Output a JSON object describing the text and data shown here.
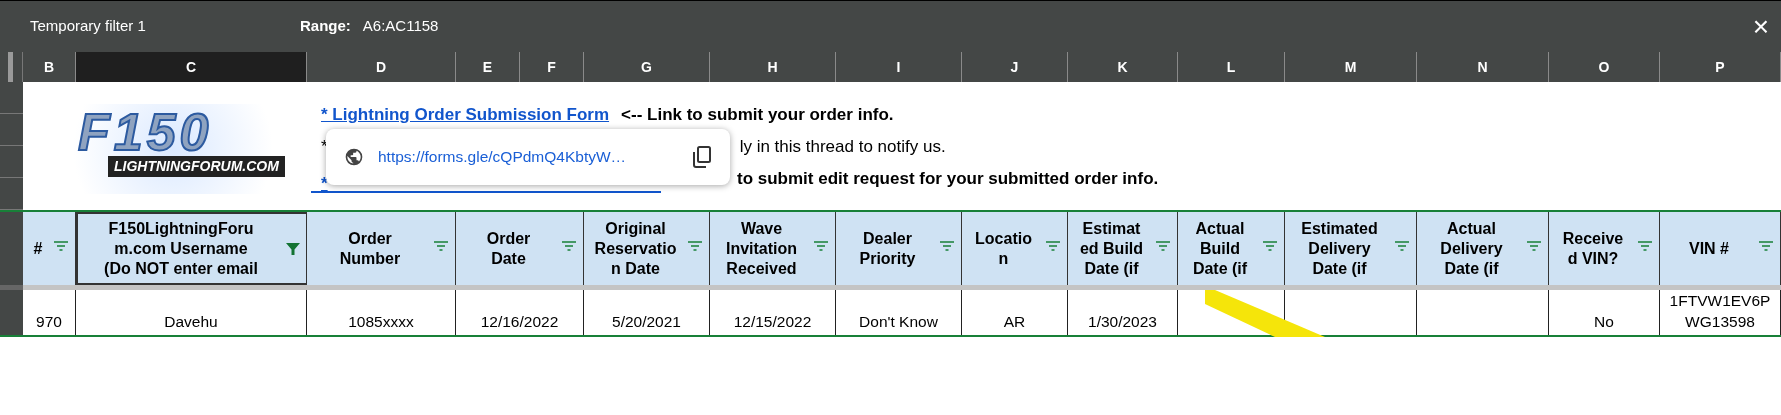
{
  "filter_bar": {
    "title": "Temporary filter 1",
    "range_label": "Range:",
    "range_value": "A6:AC1158",
    "close": "×"
  },
  "column_letters": [
    {
      "label": "B",
      "selected": false
    },
    {
      "label": "C",
      "selected": true
    },
    {
      "label": "D",
      "selected": false
    },
    {
      "label": "E",
      "selected": false
    },
    {
      "label": "F",
      "selected": false
    },
    {
      "label": "G",
      "selected": false
    },
    {
      "label": "H",
      "selected": false
    },
    {
      "label": "I",
      "selected": false
    },
    {
      "label": "J",
      "selected": false
    },
    {
      "label": "K",
      "selected": false
    },
    {
      "label": "L",
      "selected": false
    },
    {
      "label": "M",
      "selected": false
    },
    {
      "label": "N",
      "selected": false
    },
    {
      "label": "O",
      "selected": false
    },
    {
      "label": "P",
      "selected": false
    }
  ],
  "banner": {
    "logo": {
      "title": "F150",
      "subtitle": "LIGHTNINGFORUM.COM"
    },
    "lines": [
      {
        "bullet": "* Lightning Order Submission Form",
        "bullet_is_link": true,
        "text": "<-- Link to submit your order info.",
        "bold": true
      },
      {
        "bullet": "*",
        "bullet_is_link": false,
        "text": "ly in this thread to notify us.",
        "bold": false
      },
      {
        "bullet": "*",
        "bullet_is_link": true,
        "text": "to submit edit request for your submitted order info.",
        "bold": true
      }
    ],
    "link_preview": {
      "url": "https://forms.gle/cQPdmQ4KbtyW…"
    }
  },
  "header_row": [
    {
      "label": "#",
      "filtered": false
    },
    {
      "label": "F150LightningForu\nm.com Username\n(Do NOT enter email",
      "filtered": true
    },
    {
      "label": "Order\nNumber",
      "filtered": false
    },
    {
      "label": "Order\nDate",
      "filtered": false
    },
    {
      "label": "Original\nReservatio\nn Date",
      "filtered": false
    },
    {
      "label": "Wave\nInvitation\nReceived",
      "filtered": false
    },
    {
      "label": "Dealer\nPriority",
      "filtered": false
    },
    {
      "label": "Locatio\nn",
      "filtered": false
    },
    {
      "label": "Estimat\ned Build\nDate (if",
      "filtered": false
    },
    {
      "label": "Actual\nBuild\nDate (if",
      "filtered": false
    },
    {
      "label": "Estimated\nDelivery\nDate (if",
      "filtered": false
    },
    {
      "label": "Actual\nDelivery\nDate (if",
      "filtered": false
    },
    {
      "label": "Receive\nd VIN?",
      "filtered": false
    },
    {
      "label": "VIN #",
      "filtered": false
    }
  ],
  "rows": [
    {
      "cells": [
        "970",
        "Davehu",
        "1085xxxx",
        "12/16/2022",
        "5/20/2021",
        "12/15/2022",
        "Don't Know",
        "AR",
        "1/30/2023",
        null,
        null,
        null,
        "No",
        "1FTVW1EV6P\nWG13598"
      ]
    }
  ]
}
